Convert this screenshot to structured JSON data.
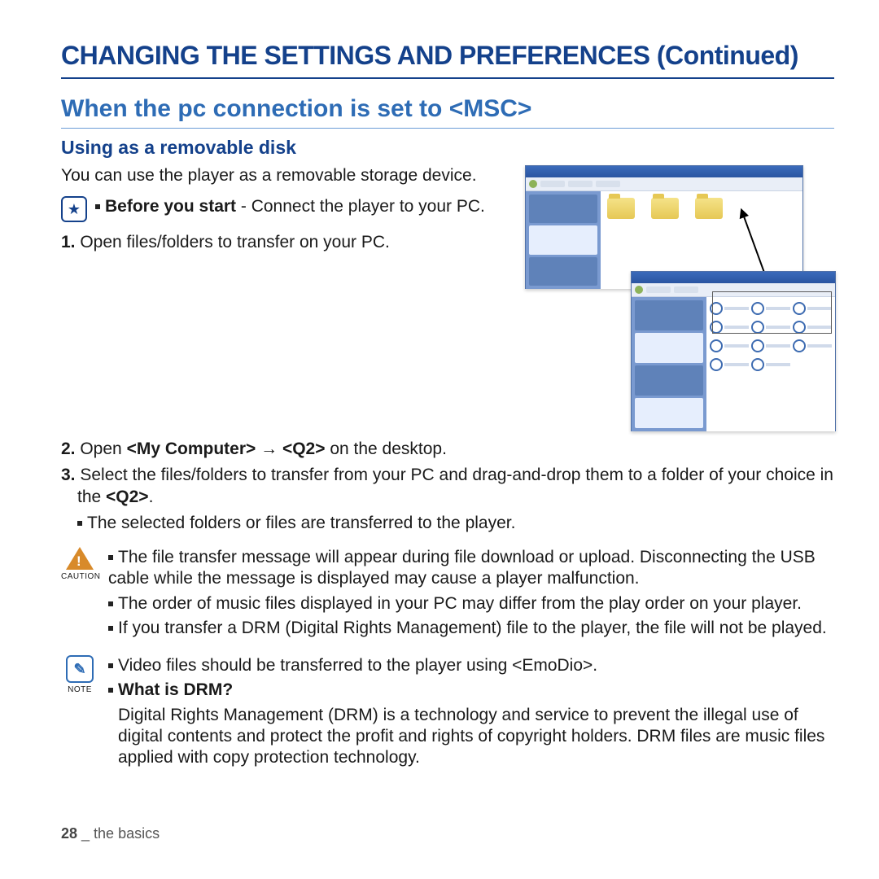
{
  "title": "CHANGING THE SETTINGS AND PREFERENCES (Continued)",
  "section_heading": "When the pc connection is set to <MSC>",
  "subheading": "Using as a removable disk",
  "intro": "You can use the player as a removable storage device.",
  "before": {
    "label": "Before you start",
    "text": " - Connect the player to your PC."
  },
  "steps": {
    "s1": {
      "num": "1.",
      "text": " Open files/folders to transfer on your PC."
    },
    "s2": {
      "num": "2.",
      "prefix": " Open ",
      "bold1": "<My Computer>",
      "arrow": " → ",
      "bold2": "<Q2>",
      "suffix": " on the desktop."
    },
    "s3": {
      "num": "3.",
      "prefix": " Select the files/folders to transfer from your PC and drag-and-drop them to a folder of your choice in the ",
      "bold1": "<Q2>",
      "suffix": "."
    },
    "sub": "The selected folders or files are transferred to the player."
  },
  "caution": {
    "label": "CAUTION",
    "b1": "The file transfer message will appear during file download or upload. Disconnecting the USB cable while the message is displayed may cause a player malfunction.",
    "b2": "The order of music files displayed in your PC may differ from the play order on your player.",
    "b3": "If you transfer a DRM (Digital Rights Management) file to the player, the file will not be played."
  },
  "note": {
    "label": "NOTE",
    "b1": "Video files should be transferred to the player using <EmoDio>.",
    "q": "What is DRM?",
    "a": "Digital Rights Management (DRM) is a technology and service to prevent the illegal use of digital contents and protect the profit and rights of copyright holders. DRM files are music files applied with copy protection technology."
  },
  "footer": {
    "page": "28",
    "sep": " _ ",
    "chapter": "the basics"
  }
}
